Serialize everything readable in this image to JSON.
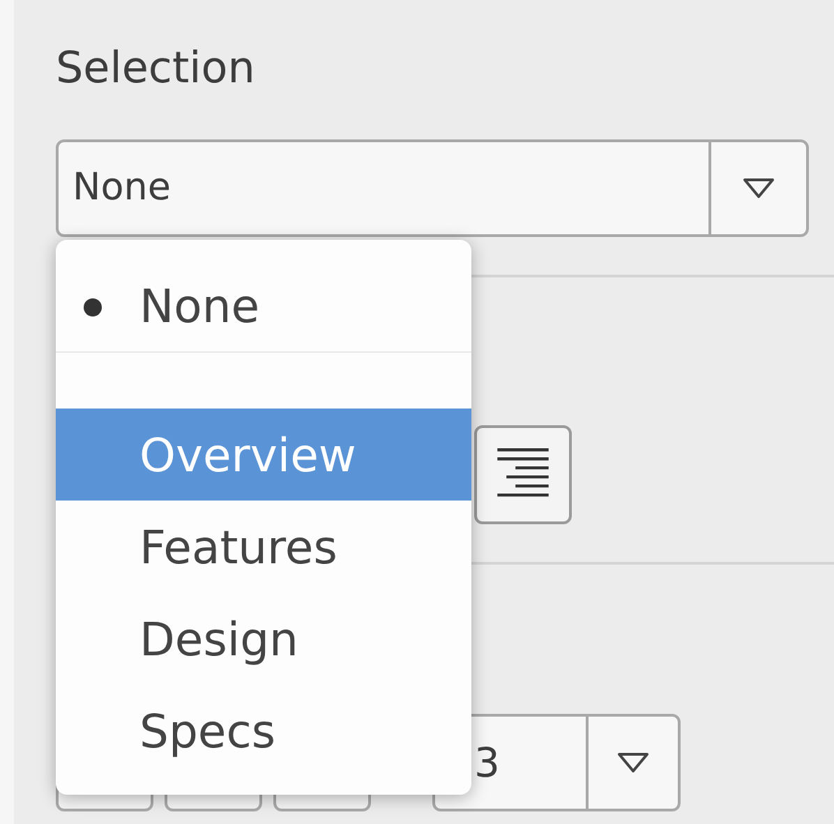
{
  "selection": {
    "label": "Selection",
    "value": "None"
  },
  "tabs_position": {
    "align_button": {
      "kind": "align-right"
    }
  },
  "text_format": {
    "font_size": {
      "value": "3"
    }
  },
  "dropdown_menu": {
    "items": [
      {
        "kind": "option",
        "label": "None",
        "checked": true,
        "selected": false
      },
      {
        "kind": "separator"
      },
      {
        "kind": "option",
        "label": "Overview",
        "checked": false,
        "selected": true
      },
      {
        "kind": "option",
        "label": "Features",
        "checked": false,
        "selected": false
      },
      {
        "kind": "option",
        "label": "Design",
        "checked": false,
        "selected": false
      },
      {
        "kind": "option",
        "label": "Specs",
        "checked": false,
        "selected": false
      }
    ]
  }
}
